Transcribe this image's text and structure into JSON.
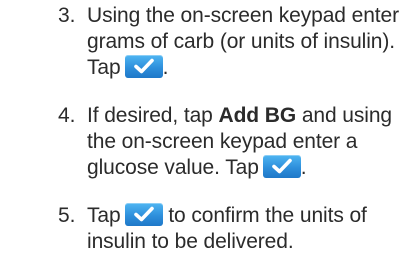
{
  "steps": [
    {
      "number": "3.",
      "line1": "Using the on-screen keypad enter",
      "line2": "grams of carb (or units of insulin).",
      "line3_pre": "Tap",
      "line3_post": "."
    },
    {
      "number": "4.",
      "line1_pre": "If desired, tap",
      "line1_bold": "Add BG",
      "line1_post": "and using",
      "line2": "the on-screen keypad enter a",
      "line3_pre": "glucose value. Tap",
      "line3_post": "."
    },
    {
      "number": "5.",
      "line1_pre": "Tap",
      "line1_post": "to confirm the units of",
      "line2": "insulin to be delivered."
    }
  ],
  "icons": {
    "confirm": "checkmark-icon"
  },
  "colors": {
    "text": "#2b2b2b",
    "button_top": "#4fb6f2",
    "button_bottom": "#1f78c8",
    "check": "#ffffff"
  }
}
